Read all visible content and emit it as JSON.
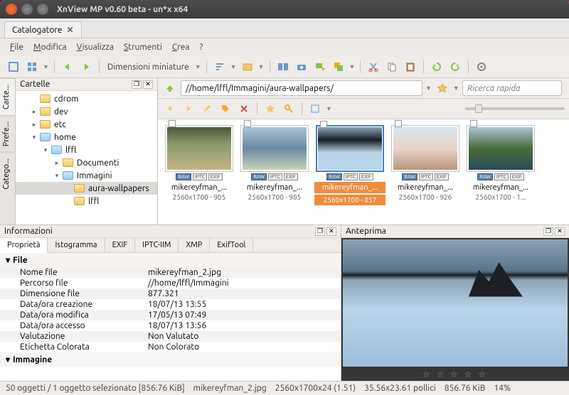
{
  "window": {
    "title": "XnView MP v0.60 beta - un*x x64"
  },
  "tab": {
    "label": "Catalogatore"
  },
  "menu": {
    "file": "File",
    "modifica": "Modifica",
    "visualizza": "Visualizza",
    "strumenti": "Strumenti",
    "crea": "Crea",
    "help": "?"
  },
  "toolbar": {
    "dim_label": "Dimensioni miniature"
  },
  "sidetabs": {
    "cartelle": "Carte...",
    "preferiti": "Prefe...",
    "categorie": "Catego..."
  },
  "folders_panel": {
    "title": "Cartelle"
  },
  "tree": {
    "cdrom": "cdrom",
    "dev": "dev",
    "etc": "etc",
    "home": "home",
    "lffl": "lffl",
    "documenti": "Documenti",
    "immagini": "Immagini",
    "aura": "aura-wallpapers",
    "lffl2": "lffl"
  },
  "path": {
    "value": "//home/lffl/Immagini/aura-wallpapers/",
    "search_placeholder": "Ricerca rapida"
  },
  "thumbs": [
    {
      "name": "mikereyfman_...",
      "dim": "2560x1700 - 905"
    },
    {
      "name": "mikereyfman_...",
      "dim": "2560x1700 - 985"
    },
    {
      "name": "mikereyfman_...",
      "dim": "2560x1700 - 857"
    },
    {
      "name": "mikereyfman_...",
      "dim": "2560x1700 - 926"
    },
    {
      "name": "mikereyfman_...",
      "dim": "2560x1700 - 1..."
    }
  ],
  "badges": {
    "raw": "RAW",
    "iptc": "IPTC",
    "exif": "EXIF"
  },
  "info": {
    "title": "Informazioni",
    "tabs": {
      "prop": "Proprietà",
      "isto": "Istogramma",
      "exif": "EXIF",
      "iptc": "IPTC-IIM",
      "xmp": "XMP",
      "exiftool": "ExifTool"
    },
    "section_file": "File",
    "section_immagine": "Immagine",
    "rows": {
      "nome_file_k": "Nome file",
      "nome_file_v": "mikereyfman_2.jpg",
      "percorso_k": "Percorso file",
      "percorso_v": "//home/lffl/Immagini",
      "dim_k": "Dimensione file",
      "dim_v": "877.321",
      "creaz_k": "Data/ora creazione",
      "creaz_v": "18/07/13 13:55",
      "modif_k": "Data/ora modifica",
      "modif_v": "17/05/13 07:49",
      "access_k": "Data/ora accesso",
      "access_v": "18/07/13 13:56",
      "valut_k": "Valutazione",
      "valut_v": "Non Valutato",
      "etich_k": "Etichetta Colorata",
      "etich_v": "Non Colorato"
    }
  },
  "preview": {
    "title": "Anteprima"
  },
  "status": {
    "sel": "50 oggetti / 1 oggetto selezionato [856.76 KiB]",
    "file": "mikereyfman_2.jpg",
    "dims": "2560x1700x24 (1.51)",
    "inches": "35.56x23.61 pollici",
    "size": "856.76 KiB",
    "zoom": "14%"
  }
}
